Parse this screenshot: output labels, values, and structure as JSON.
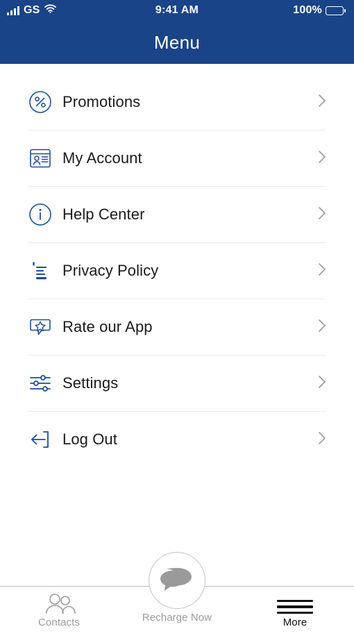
{
  "status_bar": {
    "carrier": "GS",
    "signal_icon": "signal-bars-icon",
    "wifi_icon": "wifi-icon",
    "time": "9:41 AM",
    "battery_percent": "100%",
    "battery_icon": "battery-full-icon"
  },
  "header": {
    "title": "Menu",
    "background_color": "#1a4488",
    "text_color": "#ffffff"
  },
  "theme": {
    "icon_blue": "#1a4f9c",
    "label_color": "#1b1b1b",
    "chevron_color": "#9a9a9a",
    "divider_color": "#ececec",
    "inactive_tab_color": "#9b9b9b",
    "active_tab_color": "#111111"
  },
  "menu": {
    "items": [
      {
        "label": "Promotions",
        "icon": "percent-circle-icon",
        "chevron": "chevron-right-icon",
        "divider_after": true
      },
      {
        "label": "My Account",
        "icon": "id-card-icon",
        "chevron": "chevron-right-icon",
        "divider_after": true
      },
      {
        "label": "Help Center",
        "icon": "info-circle-icon",
        "chevron": "chevron-right-icon",
        "divider_after": true
      },
      {
        "label": "Privacy Policy",
        "icon": "document-lines-icon",
        "chevron": "chevron-right-icon",
        "divider_after": true
      },
      {
        "label": "Rate our App",
        "icon": "star-speech-bubble-icon",
        "chevron": "chevron-right-icon",
        "divider_after": true
      },
      {
        "label": "Settings",
        "icon": "sliders-icon",
        "chevron": "chevron-right-icon",
        "divider_after": true
      },
      {
        "label": "Log Out",
        "icon": "logout-arrow-icon",
        "chevron": "chevron-right-icon",
        "divider_after": false
      }
    ]
  },
  "tab_bar": {
    "tabs": [
      {
        "label": "Contacts",
        "icon": "two-people-icon",
        "active": false
      },
      {
        "label": "More",
        "icon": "hamburger-menu-icon",
        "active": true
      }
    ],
    "center_action": {
      "label": "Recharge Now",
      "icon": "speech-bubbles-icon",
      "active": false
    }
  }
}
